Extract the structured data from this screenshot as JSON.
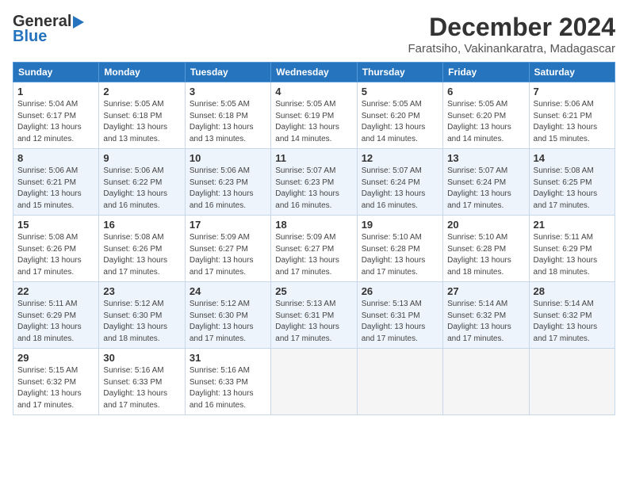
{
  "header": {
    "logo_general": "General",
    "logo_blue": "Blue",
    "month_title": "December 2024",
    "location": "Faratsiho, Vakinankaratra, Madagascar"
  },
  "weekdays": [
    "Sunday",
    "Monday",
    "Tuesday",
    "Wednesday",
    "Thursday",
    "Friday",
    "Saturday"
  ],
  "weeks": [
    [
      {
        "day": "1",
        "info": "Sunrise: 5:04 AM\nSunset: 6:17 PM\nDaylight: 13 hours\nand 12 minutes."
      },
      {
        "day": "2",
        "info": "Sunrise: 5:05 AM\nSunset: 6:18 PM\nDaylight: 13 hours\nand 13 minutes."
      },
      {
        "day": "3",
        "info": "Sunrise: 5:05 AM\nSunset: 6:18 PM\nDaylight: 13 hours\nand 13 minutes."
      },
      {
        "day": "4",
        "info": "Sunrise: 5:05 AM\nSunset: 6:19 PM\nDaylight: 13 hours\nand 14 minutes."
      },
      {
        "day": "5",
        "info": "Sunrise: 5:05 AM\nSunset: 6:20 PM\nDaylight: 13 hours\nand 14 minutes."
      },
      {
        "day": "6",
        "info": "Sunrise: 5:05 AM\nSunset: 6:20 PM\nDaylight: 13 hours\nand 14 minutes."
      },
      {
        "day": "7",
        "info": "Sunrise: 5:06 AM\nSunset: 6:21 PM\nDaylight: 13 hours\nand 15 minutes."
      }
    ],
    [
      {
        "day": "8",
        "info": "Sunrise: 5:06 AM\nSunset: 6:21 PM\nDaylight: 13 hours\nand 15 minutes."
      },
      {
        "day": "9",
        "info": "Sunrise: 5:06 AM\nSunset: 6:22 PM\nDaylight: 13 hours\nand 16 minutes."
      },
      {
        "day": "10",
        "info": "Sunrise: 5:06 AM\nSunset: 6:23 PM\nDaylight: 13 hours\nand 16 minutes."
      },
      {
        "day": "11",
        "info": "Sunrise: 5:07 AM\nSunset: 6:23 PM\nDaylight: 13 hours\nand 16 minutes."
      },
      {
        "day": "12",
        "info": "Sunrise: 5:07 AM\nSunset: 6:24 PM\nDaylight: 13 hours\nand 16 minutes."
      },
      {
        "day": "13",
        "info": "Sunrise: 5:07 AM\nSunset: 6:24 PM\nDaylight: 13 hours\nand 17 minutes."
      },
      {
        "day": "14",
        "info": "Sunrise: 5:08 AM\nSunset: 6:25 PM\nDaylight: 13 hours\nand 17 minutes."
      }
    ],
    [
      {
        "day": "15",
        "info": "Sunrise: 5:08 AM\nSunset: 6:26 PM\nDaylight: 13 hours\nand 17 minutes."
      },
      {
        "day": "16",
        "info": "Sunrise: 5:08 AM\nSunset: 6:26 PM\nDaylight: 13 hours\nand 17 minutes."
      },
      {
        "day": "17",
        "info": "Sunrise: 5:09 AM\nSunset: 6:27 PM\nDaylight: 13 hours\nand 17 minutes."
      },
      {
        "day": "18",
        "info": "Sunrise: 5:09 AM\nSunset: 6:27 PM\nDaylight: 13 hours\nand 17 minutes."
      },
      {
        "day": "19",
        "info": "Sunrise: 5:10 AM\nSunset: 6:28 PM\nDaylight: 13 hours\nand 17 minutes."
      },
      {
        "day": "20",
        "info": "Sunrise: 5:10 AM\nSunset: 6:28 PM\nDaylight: 13 hours\nand 18 minutes."
      },
      {
        "day": "21",
        "info": "Sunrise: 5:11 AM\nSunset: 6:29 PM\nDaylight: 13 hours\nand 18 minutes."
      }
    ],
    [
      {
        "day": "22",
        "info": "Sunrise: 5:11 AM\nSunset: 6:29 PM\nDaylight: 13 hours\nand 18 minutes."
      },
      {
        "day": "23",
        "info": "Sunrise: 5:12 AM\nSunset: 6:30 PM\nDaylight: 13 hours\nand 18 minutes."
      },
      {
        "day": "24",
        "info": "Sunrise: 5:12 AM\nSunset: 6:30 PM\nDaylight: 13 hours\nand 17 minutes."
      },
      {
        "day": "25",
        "info": "Sunrise: 5:13 AM\nSunset: 6:31 PM\nDaylight: 13 hours\nand 17 minutes."
      },
      {
        "day": "26",
        "info": "Sunrise: 5:13 AM\nSunset: 6:31 PM\nDaylight: 13 hours\nand 17 minutes."
      },
      {
        "day": "27",
        "info": "Sunrise: 5:14 AM\nSunset: 6:32 PM\nDaylight: 13 hours\nand 17 minutes."
      },
      {
        "day": "28",
        "info": "Sunrise: 5:14 AM\nSunset: 6:32 PM\nDaylight: 13 hours\nand 17 minutes."
      }
    ],
    [
      {
        "day": "29",
        "info": "Sunrise: 5:15 AM\nSunset: 6:32 PM\nDaylight: 13 hours\nand 17 minutes."
      },
      {
        "day": "30",
        "info": "Sunrise: 5:16 AM\nSunset: 6:33 PM\nDaylight: 13 hours\nand 17 minutes."
      },
      {
        "day": "31",
        "info": "Sunrise: 5:16 AM\nSunset: 6:33 PM\nDaylight: 13 hours\nand 16 minutes."
      },
      null,
      null,
      null,
      null
    ]
  ]
}
